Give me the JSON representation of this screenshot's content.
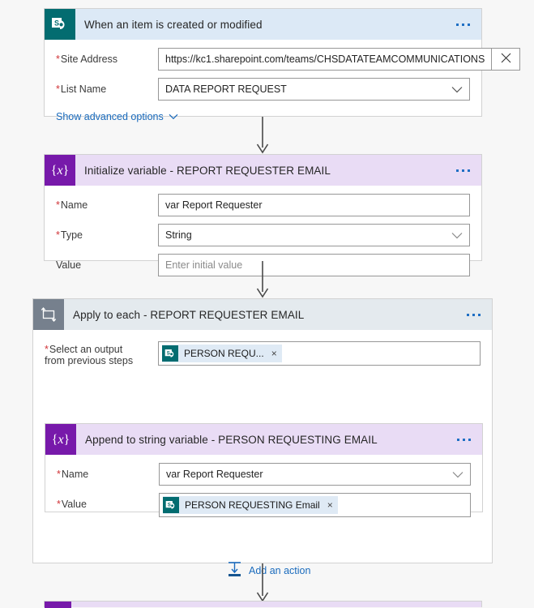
{
  "theme": {
    "page_bg": "#f7f7f7",
    "sharepoint_accent": "#036c70",
    "variable_accent": "#7719aa",
    "loop_accent": "#76808d",
    "link_blue": "#1a6bbd",
    "required_red": "#d13438",
    "sp_header_bg": "#dce9f6",
    "var_header_bg": "#e9dcf5",
    "loop_header_bg": "#e4eaee"
  },
  "trigger_card": {
    "title": "When an item is created or modified",
    "icon": "sharepoint-icon",
    "overflow_label": "...",
    "fields": [
      {
        "label": "Site Address",
        "required": true,
        "value": "https://kc1.sharepoint.com/teams/CHSDATATEAMCOMMUNICATIONS",
        "control": "text-with-clear",
        "clear_icon": "close-icon"
      },
      {
        "label": "List Name",
        "required": true,
        "value": "DATA REPORT REQUEST",
        "control": "dropdown",
        "chevron_icon": "chevron-down-icon"
      }
    ],
    "advanced_link": "Show advanced options",
    "advanced_link_icon": "chevron-down-icon"
  },
  "init_variable_card": {
    "title": "Initialize variable - REPORT REQUESTER EMAIL",
    "icon": "variable-icon",
    "overflow_label": "...",
    "fields": [
      {
        "label": "Name",
        "required": true,
        "value": "var Report Requester",
        "control": "text"
      },
      {
        "label": "Type",
        "required": true,
        "value": "String",
        "control": "dropdown",
        "chevron_icon": "chevron-down-icon"
      },
      {
        "label": "Value",
        "required": false,
        "value": "",
        "placeholder": "Enter initial value",
        "control": "text"
      }
    ]
  },
  "apply_to_each_card": {
    "title": "Apply to each - REPORT REQUESTER EMAIL",
    "icon": "loop-icon",
    "overflow_label": "...",
    "select_output": {
      "label_line1": "Select an output",
      "label_line2": "from previous steps",
      "required": true,
      "token": {
        "text": "PERSON REQU...",
        "icon": "sharepoint-icon",
        "remove_icon": "close-icon"
      }
    },
    "add_action": {
      "label": "Add an action",
      "icon": "insert-action-icon"
    }
  },
  "append_card": {
    "title": "Append to string variable - PERSON REQUESTING EMAIL",
    "icon": "variable-icon",
    "overflow_label": "...",
    "fields": [
      {
        "label": "Name",
        "required": true,
        "value": "var Report Requester",
        "control": "dropdown",
        "chevron_icon": "chevron-down-icon"
      }
    ],
    "value_field": {
      "label": "Value",
      "required": true,
      "token": {
        "text": "PERSON REQUESTING Email",
        "icon": "sharepoint-icon",
        "remove_icon": "close-icon"
      }
    }
  },
  "connectors": [
    {
      "name": "connector-trigger-to-init"
    },
    {
      "name": "connector-init-to-loop"
    },
    {
      "name": "connector-loop-to-next"
    }
  ],
  "next_card_partial": {
    "icon": "variable-icon"
  }
}
